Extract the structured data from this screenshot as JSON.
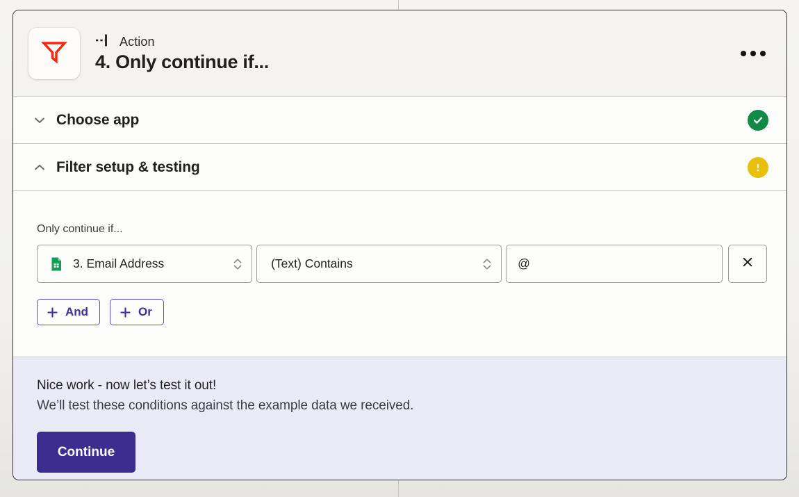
{
  "colors": {
    "accent_purple": "#3c2d8f",
    "filter_red": "#f4280c",
    "success_green": "#108a45",
    "warning_yellow": "#e8c00a",
    "sheets_green": "#0f9d58",
    "panel_lavender": "#ebebf7"
  },
  "header": {
    "app_icon_name": "zapier-filter-icon",
    "step_type_icon": "action-step-icon",
    "step_type_label": "Action",
    "step_title": "4. Only continue if...",
    "menu_label": "more-options"
  },
  "sections": [
    {
      "id": "choose-app",
      "title": "Choose app",
      "expanded": false,
      "chevron": "chevron-down-icon",
      "status": "complete",
      "status_icon": "check-circle-icon"
    },
    {
      "id": "filter-setup-testing",
      "title": "Filter setup & testing",
      "expanded": true,
      "chevron": "chevron-up-icon",
      "status": "warning",
      "status_icon": "warning-circle-icon"
    }
  ],
  "filter": {
    "label": "Only continue if...",
    "condition": {
      "field": {
        "icon": "google-sheets-icon",
        "value": "3. Email Address",
        "stepper_icon": "up-down-chevron-icon"
      },
      "operator": {
        "value": "(Text) Contains",
        "stepper_icon": "up-down-chevron-icon"
      },
      "value": {
        "text": "@",
        "placeholder": ""
      },
      "remove_label": "remove-condition",
      "remove_icon": "close-icon"
    },
    "logic_buttons": [
      {
        "id": "and",
        "label": "And",
        "icon": "plus-icon"
      },
      {
        "id": "or",
        "label": "Or",
        "icon": "plus-icon"
      }
    ]
  },
  "footer": {
    "headline": "Nice work - now let’s test it out!",
    "subtext": "We’ll test these conditions against the example data we received.",
    "continue_label": "Continue"
  }
}
